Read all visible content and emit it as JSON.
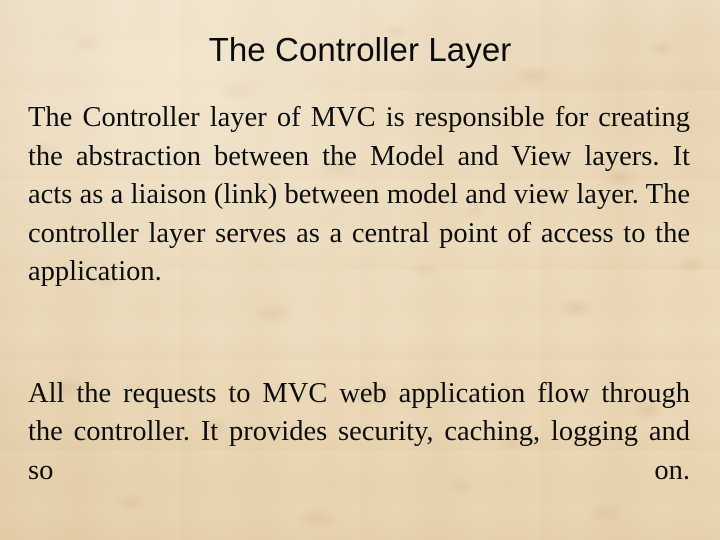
{
  "slide": {
    "title": "The Controller Layer",
    "background_color": "#ecdcbd",
    "text_color": "#0d0d0d",
    "title_color": "#0b0b0b",
    "paragraphs": [
      "The Controller layer of MVC is responsible for creating the abstraction between the Model and View layers. It acts as a liaison (link) between model and view layer. The controller layer serves as a central point of access to the application.",
      "All the requests to MVC web application flow through the controller. It provides security, caching, logging and so on."
    ]
  }
}
